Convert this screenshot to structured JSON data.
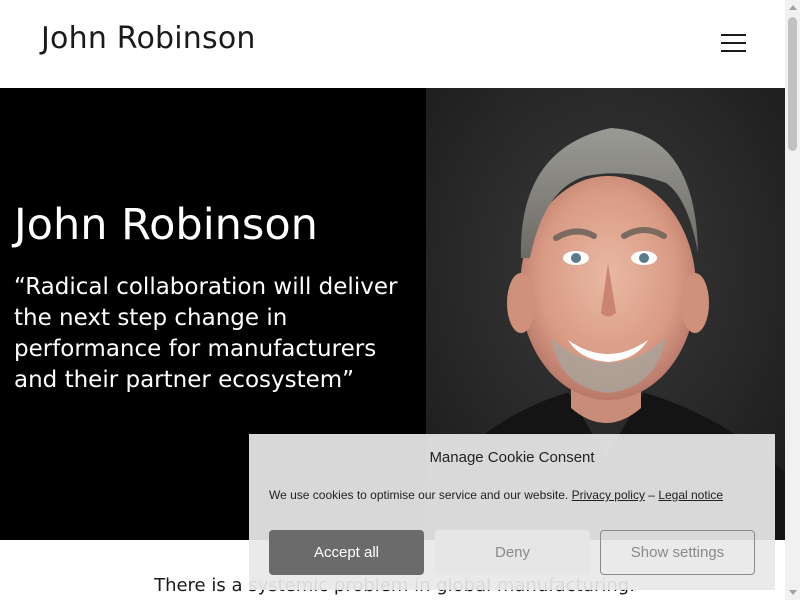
{
  "header": {
    "site_title": "John Robinson",
    "menu_icon": "hamburger-menu-icon"
  },
  "hero": {
    "name": "John Robinson",
    "quote": "“Radical collaboration will deliver the next step change in performance for manufacturers and their partner ecosystem”",
    "background_color": "#000000",
    "portrait": "portrait-photo"
  },
  "intro": {
    "text": "There is a systemic problem in global manufacturing."
  },
  "cookie_banner": {
    "title": "Manage Cookie Consent",
    "message": "We use cookies to optimise our service and our website.",
    "privacy_link": "Privacy policy",
    "separator": " – ",
    "legal_link": "Legal notice",
    "accept_label": "Accept all",
    "deny_label": "Deny",
    "settings_label": "Show settings",
    "accept_color": "#6b6b6b"
  }
}
